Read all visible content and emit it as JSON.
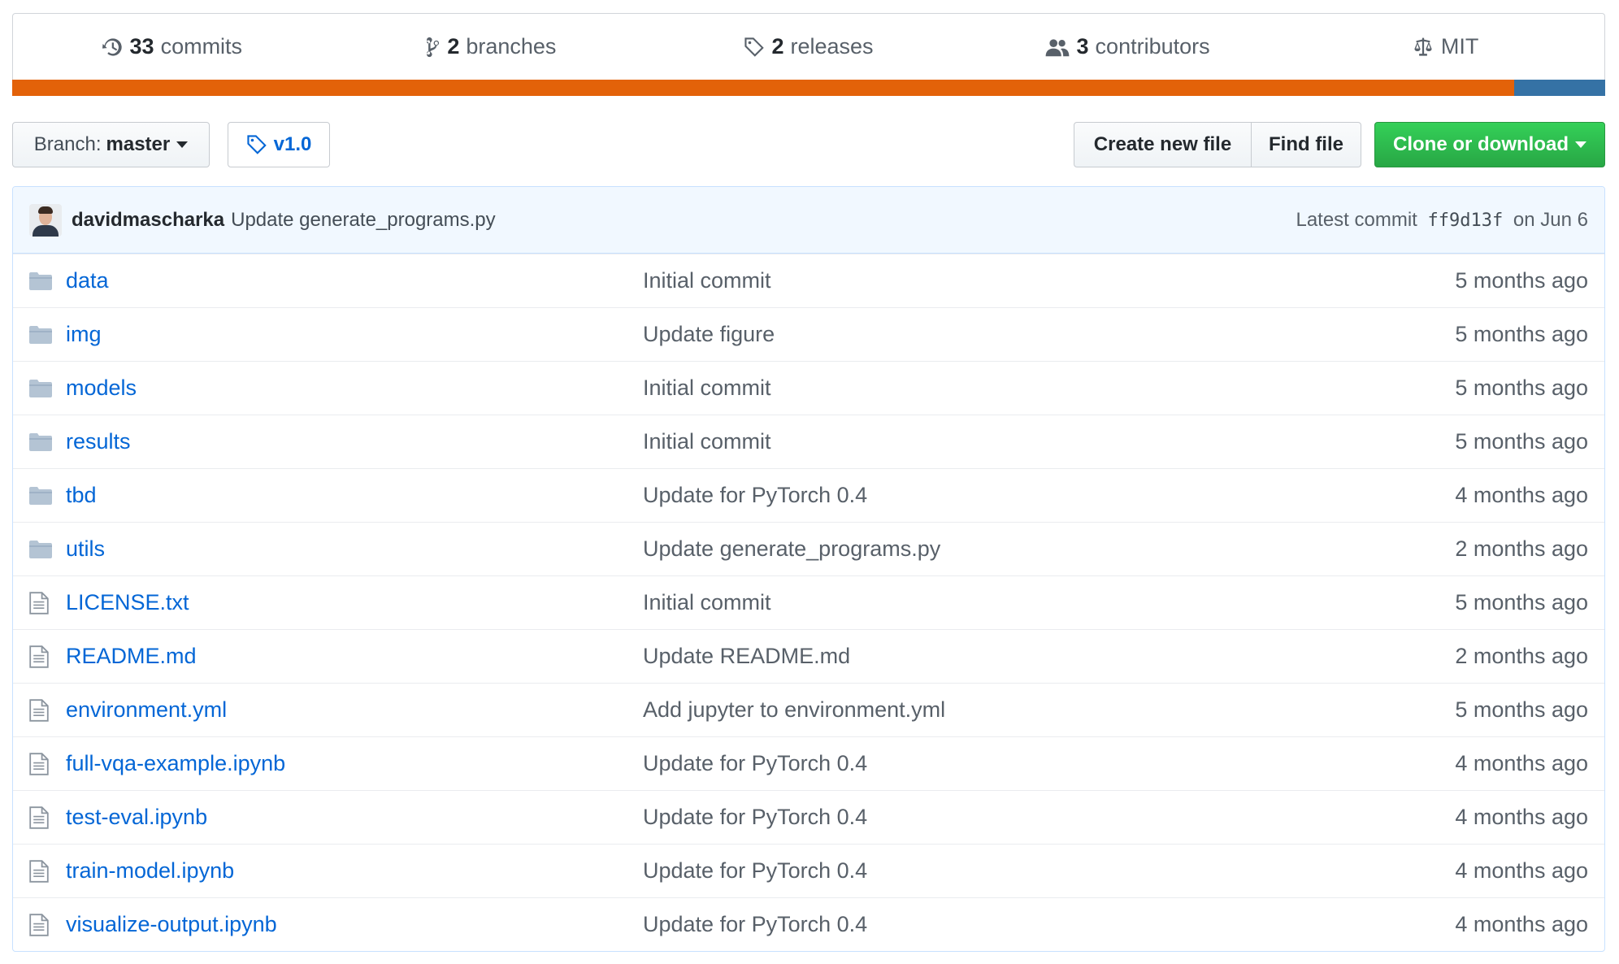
{
  "summary": {
    "commits": {
      "count": "33",
      "label": "commits"
    },
    "branches": {
      "count": "2",
      "label": "branches"
    },
    "releases": {
      "count": "2",
      "label": "releases"
    },
    "contributors": {
      "count": "3",
      "label": "contributors"
    },
    "license": {
      "label": "MIT"
    }
  },
  "language_bar": [
    {
      "color": "#e36209",
      "fraction": 0.943
    },
    {
      "color": "#3572a5",
      "fraction": 0.057
    }
  ],
  "toolbar": {
    "branch_prefix": "Branch:",
    "branch_name": "master",
    "tag_label": "v1.0",
    "create_new_file": "Create new file",
    "find_file": "Find file",
    "clone_or_download": "Clone or download"
  },
  "latest_commit": {
    "author": "davidmascharka",
    "message": "Update generate_programs.py",
    "prefix": "Latest commit",
    "sha": "ff9d13f",
    "date": "on Jun 6"
  },
  "files": [
    {
      "type": "dir",
      "name": "data",
      "message": "Initial commit",
      "age": "5 months ago"
    },
    {
      "type": "dir",
      "name": "img",
      "message": "Update figure",
      "age": "5 months ago"
    },
    {
      "type": "dir",
      "name": "models",
      "message": "Initial commit",
      "age": "5 months ago"
    },
    {
      "type": "dir",
      "name": "results",
      "message": "Initial commit",
      "age": "5 months ago"
    },
    {
      "type": "dir",
      "name": "tbd",
      "message": "Update for PyTorch 0.4",
      "age": "4 months ago"
    },
    {
      "type": "dir",
      "name": "utils",
      "message": "Update generate_programs.py",
      "age": "2 months ago"
    },
    {
      "type": "file",
      "name": "LICENSE.txt",
      "message": "Initial commit",
      "age": "5 months ago"
    },
    {
      "type": "file",
      "name": "README.md",
      "message": "Update README.md",
      "age": "2 months ago"
    },
    {
      "type": "file",
      "name": "environment.yml",
      "message": "Add jupyter to environment.yml",
      "age": "5 months ago"
    },
    {
      "type": "file",
      "name": "full-vqa-example.ipynb",
      "message": "Update for PyTorch 0.4",
      "age": "4 months ago"
    },
    {
      "type": "file",
      "name": "test-eval.ipynb",
      "message": "Update for PyTorch 0.4",
      "age": "4 months ago"
    },
    {
      "type": "file",
      "name": "train-model.ipynb",
      "message": "Update for PyTorch 0.4",
      "age": "4 months ago"
    },
    {
      "type": "file",
      "name": "visualize-output.ipynb",
      "message": "Update for PyTorch 0.4",
      "age": "4 months ago"
    }
  ]
}
